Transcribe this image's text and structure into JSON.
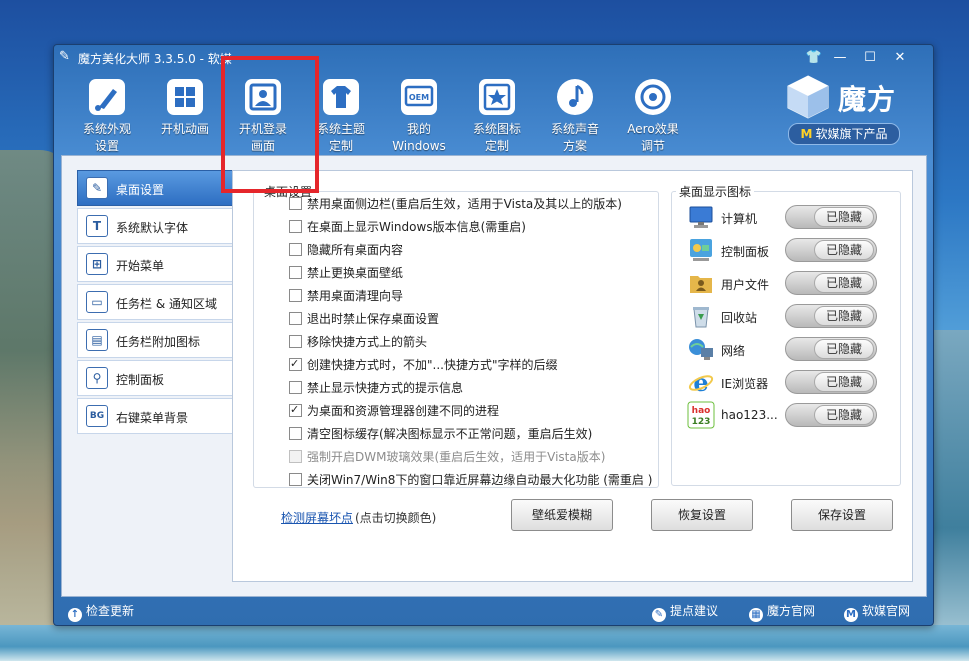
{
  "window": {
    "title": "魔方美化大师 3.3.5.0 - 软媒",
    "controls": [
      "shirt-icon",
      "minimize",
      "maximize",
      "close"
    ]
  },
  "toolbar": [
    {
      "label": "系统外观\n设置",
      "icon": "paint-brush-icon"
    },
    {
      "label": "开机动画",
      "icon": "windows-logo-icon"
    },
    {
      "label": "开机登录\n画面",
      "icon": "user-login-icon"
    },
    {
      "label": "系统主题\n定制",
      "icon": "tshirt-icon"
    },
    {
      "label": "我的\nWindows",
      "icon": "oem-icon"
    },
    {
      "label": "系统图标\n定制",
      "icon": "star-icon"
    },
    {
      "label": "系统声音\n方案",
      "icon": "music-note-icon"
    },
    {
      "label": "Aero效果\n调节",
      "icon": "aero-circle-icon"
    }
  ],
  "brand": {
    "name": "魔方",
    "badge_mark": "M",
    "badge": "软媒旗下产品"
  },
  "sidebar": [
    {
      "label": "桌面设置",
      "icon": "wrench-icon",
      "glyph": "✎",
      "active": true
    },
    {
      "label": "系统默认字体",
      "icon": "font-icon",
      "glyph": "T",
      "active": false
    },
    {
      "label": "开始菜单",
      "icon": "start-menu-icon",
      "glyph": "⊞",
      "active": false
    },
    {
      "label": "任务栏 & 通知区域",
      "icon": "taskbar-icon",
      "glyph": "▭",
      "active": false
    },
    {
      "label": "任务栏附加图标",
      "icon": "taskbar-addon-icon",
      "glyph": "▤",
      "active": false
    },
    {
      "label": "控制面板",
      "icon": "control-panel-icon",
      "glyph": "⚲",
      "active": false
    },
    {
      "label": "右键菜单背景",
      "icon": "bg-icon",
      "glyph": "BG",
      "active": false
    }
  ],
  "desktop_settings": {
    "title": "桌面设置",
    "options": [
      {
        "label": "禁用桌面侧边栏(重启后生效，适用于Vista及其以上的版本)",
        "checked": false,
        "disabled": false
      },
      {
        "label": "在桌面上显示Windows版本信息(需重启)",
        "checked": false,
        "disabled": false
      },
      {
        "label": "隐藏所有桌面内容",
        "checked": false,
        "disabled": false
      },
      {
        "label": "禁止更换桌面壁纸",
        "checked": false,
        "disabled": false
      },
      {
        "label": "禁用桌面清理向导",
        "checked": false,
        "disabled": false
      },
      {
        "label": "退出时禁止保存桌面设置",
        "checked": false,
        "disabled": false
      },
      {
        "label": "移除快捷方式上的箭头",
        "checked": false,
        "disabled": false
      },
      {
        "label": "创建快捷方式时，不加\"...快捷方式\"字样的后缀",
        "checked": true,
        "disabled": false
      },
      {
        "label": "禁止显示快捷方式的提示信息",
        "checked": false,
        "disabled": false
      },
      {
        "label": "为桌面和资源管理器创建不同的进程",
        "checked": true,
        "disabled": false
      },
      {
        "label": "清空图标缓存(解决图标显示不正常问题，重启后生效)",
        "checked": false,
        "disabled": false
      },
      {
        "label": "强制开启DWM玻璃效果(重启后生效，适用于Vista版本)",
        "checked": false,
        "disabled": true
      },
      {
        "label": "关闭Win7/Win8下的窗口靠近屏幕边缘自动最大化功能 (需重启 )",
        "checked": false,
        "disabled": false
      }
    ]
  },
  "desktop_icons": {
    "title": "桌面显示图标",
    "items": [
      {
        "label": "计算机",
        "icon": "computer-icon",
        "state": "已隐藏",
        "color": "#3a7bd5"
      },
      {
        "label": "控制面板",
        "icon": "control-panel-icon",
        "state": "已隐藏",
        "color": "#4aa3df"
      },
      {
        "label": "用户文件",
        "icon": "user-folder-icon",
        "state": "已隐藏",
        "color": "#e5b64a"
      },
      {
        "label": "回收站",
        "icon": "recycle-bin-icon",
        "state": "已隐藏",
        "color": "#9fb8cf"
      },
      {
        "label": "网络",
        "icon": "network-icon",
        "state": "已隐藏",
        "color": "#3b8fd8"
      },
      {
        "label": "IE浏览器",
        "icon": "ie-icon",
        "state": "已隐藏",
        "color": "#1e7fd6"
      },
      {
        "label": "hao123...",
        "icon": "hao123-icon",
        "state": "已隐藏",
        "color": "#6cbf3c"
      }
    ]
  },
  "bottom": {
    "link": "检测屏幕坏点",
    "link_note": "(点击切换颜色)",
    "buttons": [
      "壁纸爱模糊",
      "恢复设置",
      "保存设置"
    ]
  },
  "footer": {
    "update": "检查更新",
    "feedback": "提点建议",
    "site1": "魔方官网",
    "site2": "软媒官网"
  }
}
